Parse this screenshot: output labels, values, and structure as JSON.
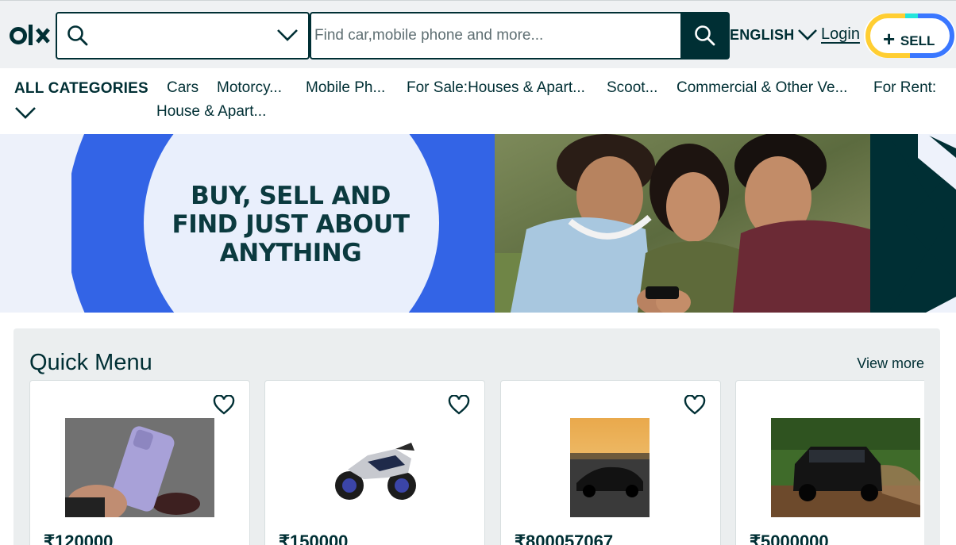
{
  "header": {
    "brand": "olx",
    "search_placeholder": "Find car,mobile phone and more...",
    "language": "ENGLISH",
    "login_label": "Login",
    "sell_label": "SELL",
    "sell_plus": "+"
  },
  "categories": {
    "all_label": "ALL CATEGORIES",
    "items": [
      "Cars",
      "Motorcy...",
      "Mobile Ph...",
      "For Sale:Houses & Apart...",
      "Scoot...",
      "Commercial & Other Ve...",
      "For Rent:",
      "House & Apart..."
    ]
  },
  "banner": {
    "line1": "BUY, SELL AND",
    "line2": "FIND JUST ABOUT",
    "line3": "ANYTHING"
  },
  "quick_menu": {
    "title": "Quick Menu",
    "view_more": "View more",
    "cards": [
      {
        "price": "₹120000",
        "image": "purple-phone"
      },
      {
        "price": "₹150000",
        "image": "sport-motorcycle"
      },
      {
        "price": "₹800057067",
        "image": "black-sports-car"
      },
      {
        "price": "₹5000000",
        "image": "black-suv"
      }
    ]
  },
  "colors": {
    "brand_dark": "#002f34",
    "accent_blue": "#3a77ff",
    "accent_yellow": "#ffce32",
    "accent_teal": "#23e5db",
    "panel_bg": "#ebeeef"
  }
}
